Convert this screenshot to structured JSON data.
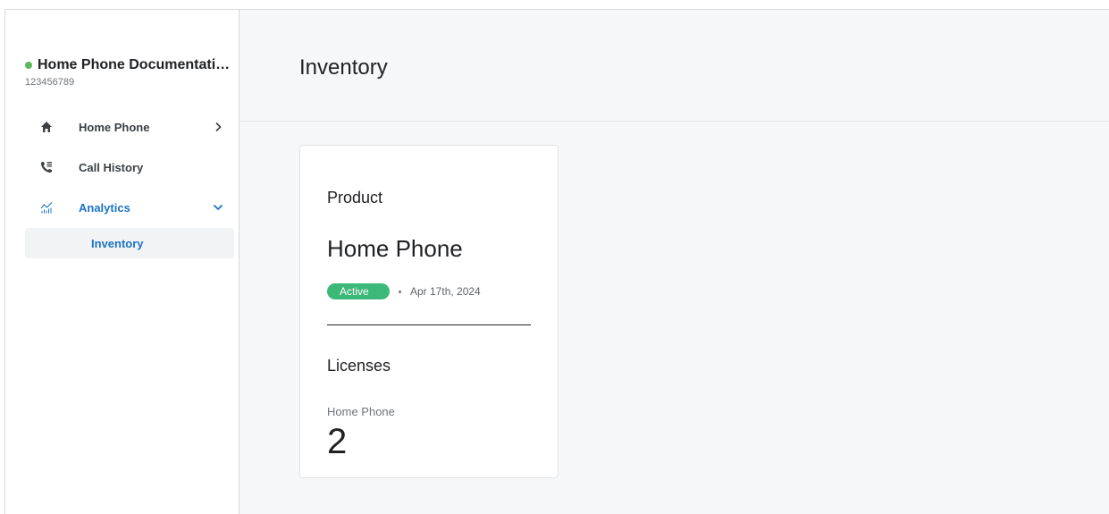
{
  "account": {
    "name": "Home Phone Documentati…",
    "id": "123456789",
    "status_color": "#5cb85c"
  },
  "sidebar": {
    "items": [
      {
        "label": "Home Phone",
        "icon": "home-icon",
        "chevron": "chevron-right-icon"
      },
      {
        "label": "Call History",
        "icon": "call-log-icon"
      },
      {
        "label": "Analytics",
        "icon": "analytics-icon",
        "chevron": "chevron-down-icon",
        "active": true
      }
    ],
    "sub_items": [
      {
        "label": "Inventory",
        "selected": true
      }
    ],
    "accent_color": "#1a73c6"
  },
  "main": {
    "title": "Inventory",
    "card": {
      "product_heading": "Product",
      "product_name": "Home Phone",
      "status_badge": "Active",
      "status_badge_color": "#3cb878",
      "status_date": "Apr 17th, 2024",
      "licenses_heading": "Licenses",
      "license_label": "Home Phone",
      "license_count": "2"
    }
  }
}
